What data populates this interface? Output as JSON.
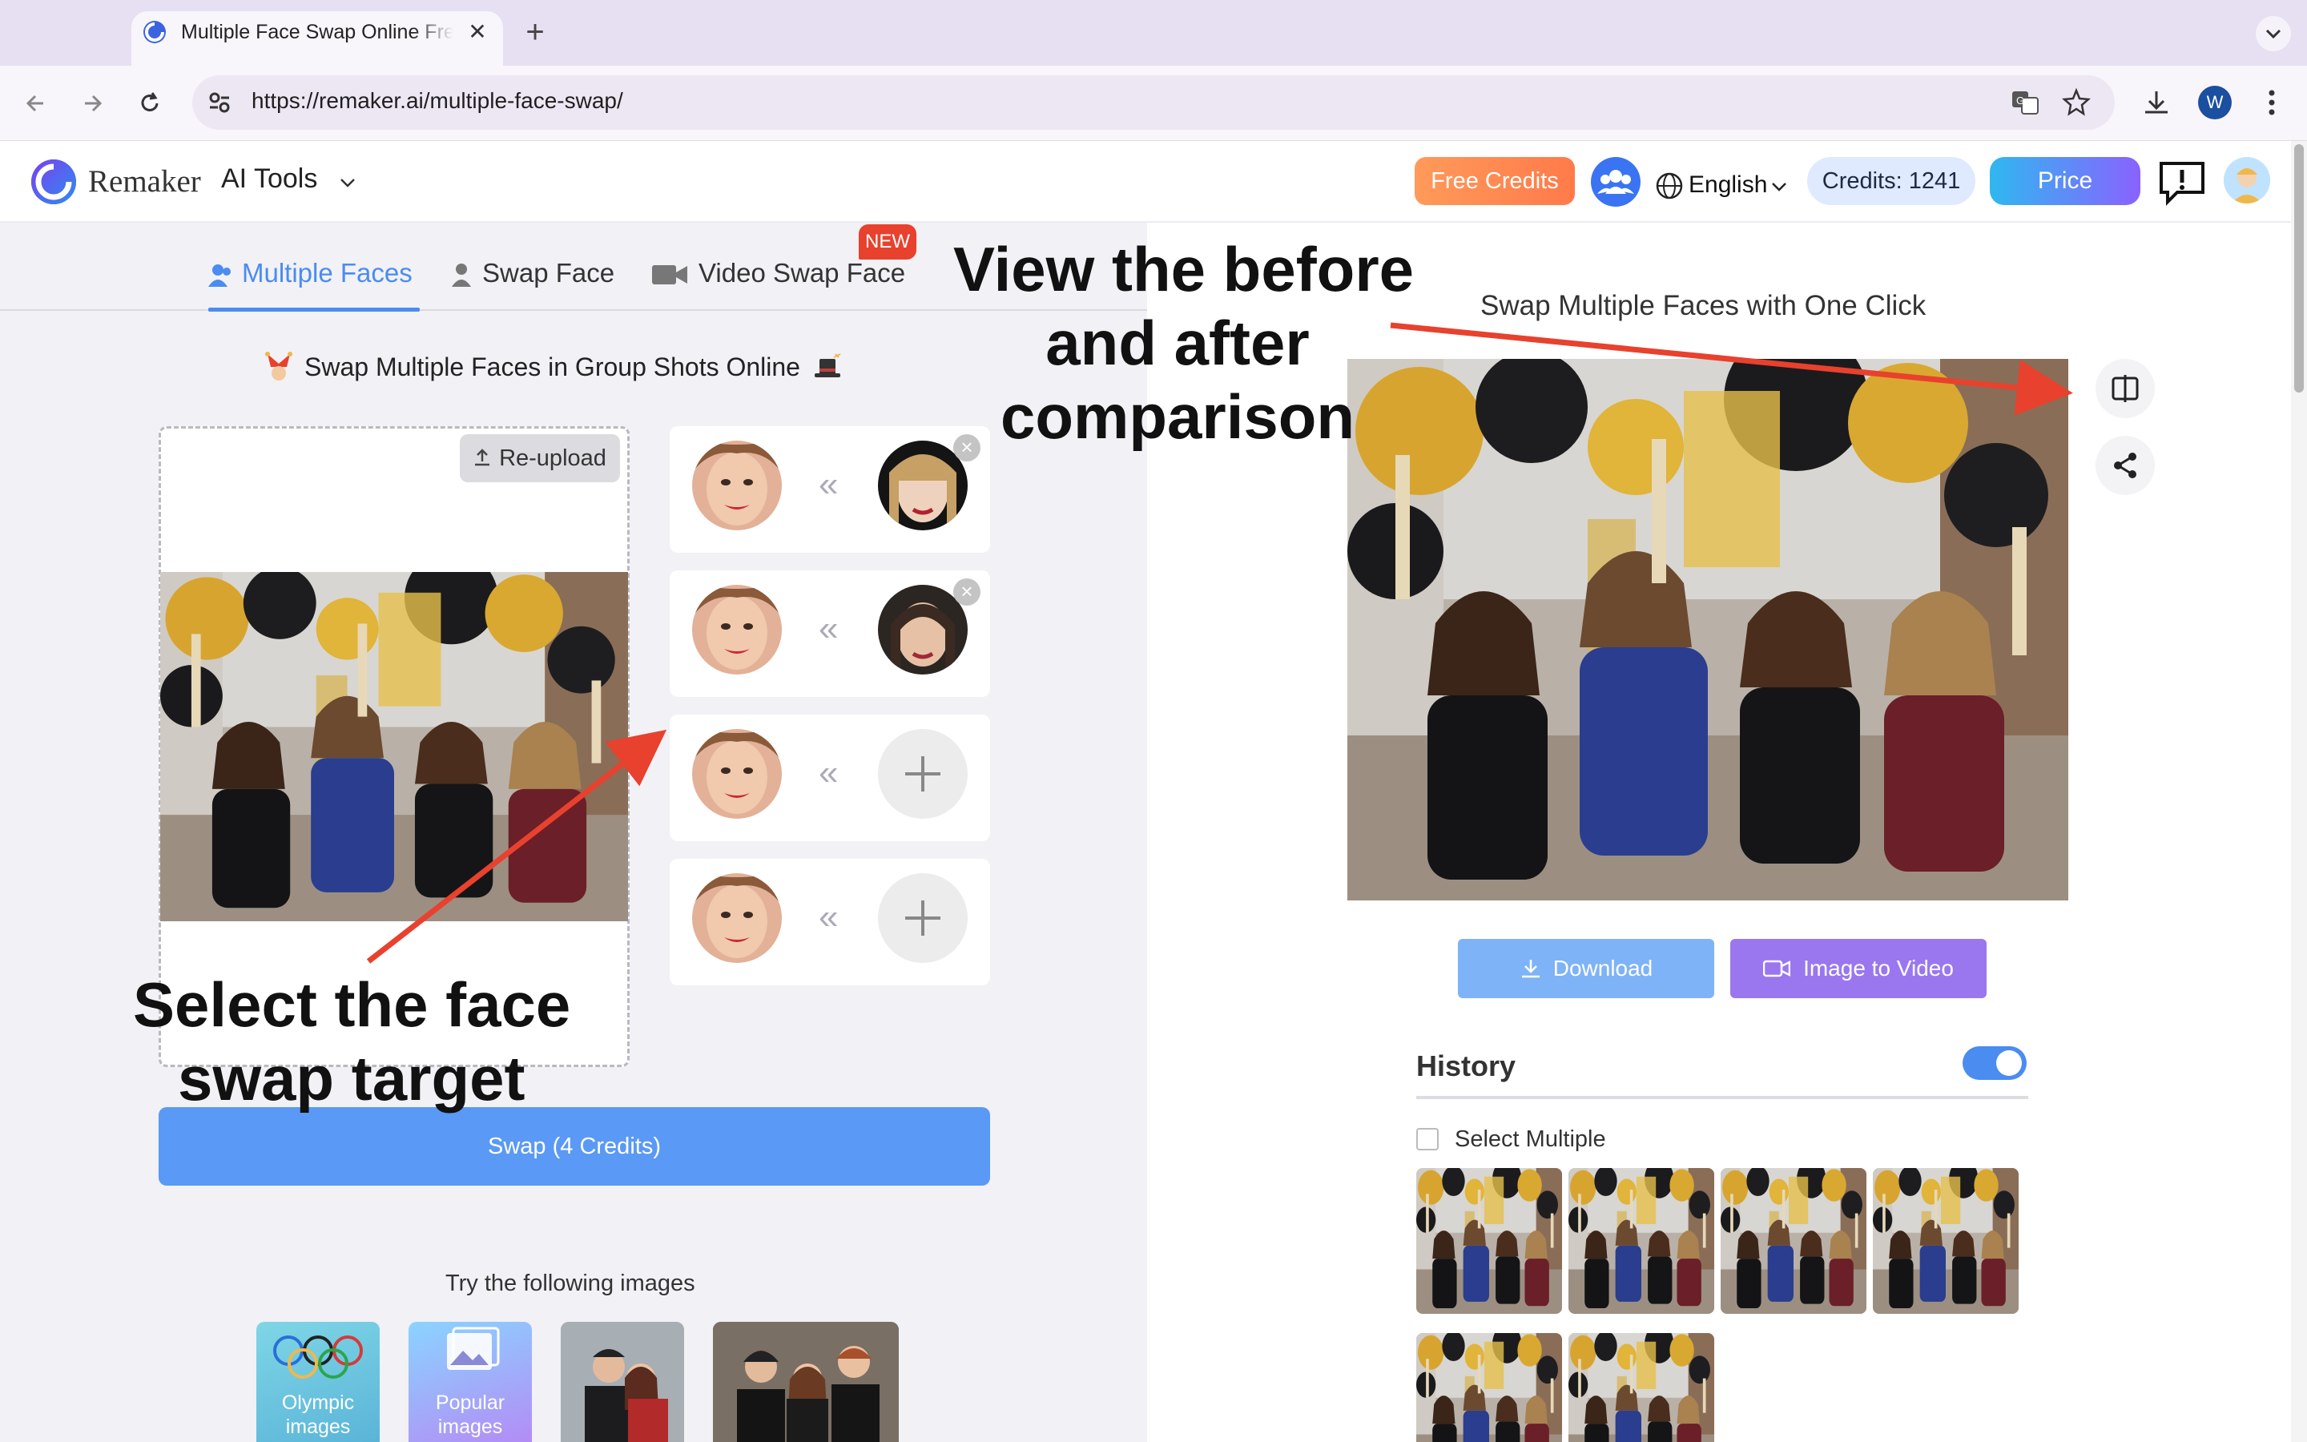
{
  "browser": {
    "tab_title": "Multiple Face Swap Online Free",
    "url": "https://remaker.ai/multiple-face-swap/",
    "profile_initial": "W"
  },
  "header": {
    "logo_text": "Remaker",
    "ai_tools": "AI Tools",
    "free_credits": "Free Credits",
    "language": "English",
    "credits": "Credits: 1241",
    "price": "Price"
  },
  "tabs": {
    "multiple": "Multiple Faces",
    "swap": "Swap Face",
    "video": "Video Swap Face",
    "new_badge": "NEW"
  },
  "main": {
    "subtitle": "Swap Multiple Faces in Group Shots Online",
    "reupload": "Re-upload",
    "swap_button": "Swap (4 Credits)",
    "try_text": "Try the following images",
    "samples": [
      "Olympic images",
      "Popular images"
    ]
  },
  "annotations": {
    "before_after": [
      "View the before",
      "and after",
      "comparison"
    ],
    "select_target": [
      "Select the face",
      "swap target"
    ]
  },
  "result": {
    "title": "Swap Multiple Faces with One Click",
    "download": "Download",
    "image_to_video": "Image to Video"
  },
  "history": {
    "title": "History",
    "select_multiple": "Select Multiple",
    "toggle_on": true
  },
  "colors": {
    "accent": "#4a8cf0",
    "annotation_arrow": "#e8412d",
    "free_credits": "#ff8a50",
    "image_to_video": "#9a77ef"
  }
}
